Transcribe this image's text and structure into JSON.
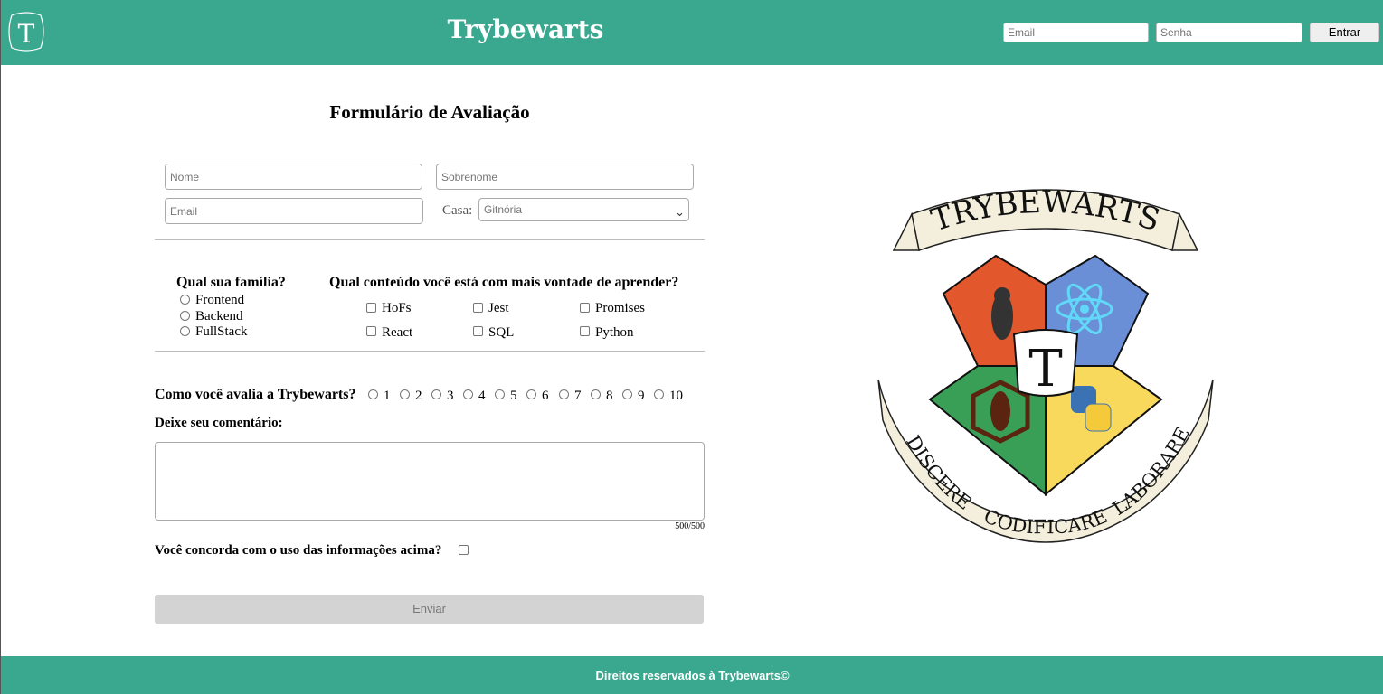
{
  "header": {
    "logo_letter": "T",
    "title": "Trybewarts",
    "email_placeholder": "Email",
    "senha_placeholder": "Senha",
    "login_label": "Entrar"
  },
  "form": {
    "title": "Formulário de Avaliação",
    "nome_placeholder": "Nome",
    "sobrenome_placeholder": "Sobrenome",
    "email_placeholder": "Email",
    "casa_label": "Casa:",
    "casa_selected": "Gitnória",
    "family_question": "Qual sua família?",
    "families": [
      "Frontend",
      "Backend",
      "FullStack"
    ],
    "content_question": "Qual conteúdo você está com mais vontade de aprender?",
    "contents": [
      "HoFs",
      "Jest",
      "Promises",
      "React",
      "SQL",
      "Python"
    ],
    "rate_question": "Como você avalia a Trybewarts?",
    "rates": [
      "1",
      "2",
      "3",
      "4",
      "5",
      "6",
      "7",
      "8",
      "9",
      "10"
    ],
    "comment_label": "Deixe seu comentário:",
    "counter": "500/500",
    "agree_label": "Você concorda com o uso das informações acima?",
    "submit_label": "Enviar"
  },
  "crest": {
    "banner": "TRYBEWARTS",
    "letter": "T",
    "motto_left": "DISCERE",
    "motto_center": "CODIFICARE",
    "motto_right": "LABORARE",
    "colors": {
      "red": "#e2572c",
      "blue": "#6a8fd6",
      "green": "#3a9f56",
      "yellow": "#f9d95c",
      "parchment": "#f4efdc"
    }
  },
  "footer": {
    "text": "Direitos reservados à Trybewarts©"
  },
  "theme": {
    "primary": "#3aa88f"
  }
}
